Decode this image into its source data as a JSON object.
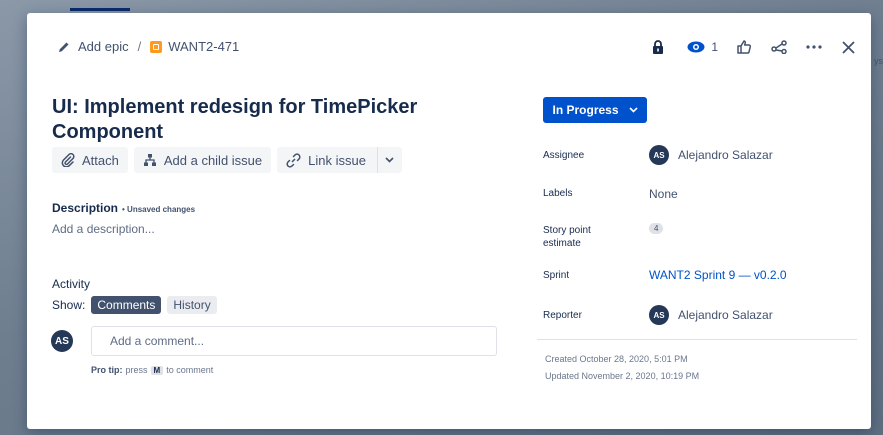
{
  "breadcrumb": {
    "add_epic": "Add epic",
    "separator": "/",
    "issue_key": "WANT2-471"
  },
  "header_actions": {
    "watch_count": "1"
  },
  "issue": {
    "title": "UI: Implement redesign for TimePicker Component"
  },
  "actions": {
    "attach": "Attach",
    "add_child": "Add a child issue",
    "link_issue": "Link issue"
  },
  "description": {
    "label": "Description",
    "unsaved": "• Unsaved changes",
    "placeholder": "Add a description..."
  },
  "activity": {
    "label": "Activity",
    "show_label": "Show:",
    "tabs": [
      "Comments",
      "History"
    ],
    "comment_placeholder": "Add a comment...",
    "avatar_initials": "AS",
    "protip_prefix": "Pro tip:",
    "protip_press": "press",
    "protip_key": "M",
    "protip_suffix": "to comment"
  },
  "status": {
    "label": "In Progress"
  },
  "fields": {
    "assignee_label": "Assignee",
    "assignee_initials": "AS",
    "assignee_name": "Alejandro Salazar",
    "labels_label": "Labels",
    "labels_value": "None",
    "story_points_label_1": "Story point",
    "story_points_label_2": "estimate",
    "story_points_value": "4",
    "sprint_label": "Sprint",
    "sprint_value": "WANT2 Sprint 9 — v0.2.0",
    "reporter_label": "Reporter",
    "reporter_initials": "AS",
    "reporter_name": "Alejandro Salazar"
  },
  "meta": {
    "created": "Created October 28, 2020, 5:01 PM",
    "updated": "Updated November 2, 2020, 10:19 PM"
  },
  "edge_fragment": "ys",
  "colors": {
    "accent": "#0052CC",
    "story": "#FF991F",
    "text": "#172B4D"
  }
}
